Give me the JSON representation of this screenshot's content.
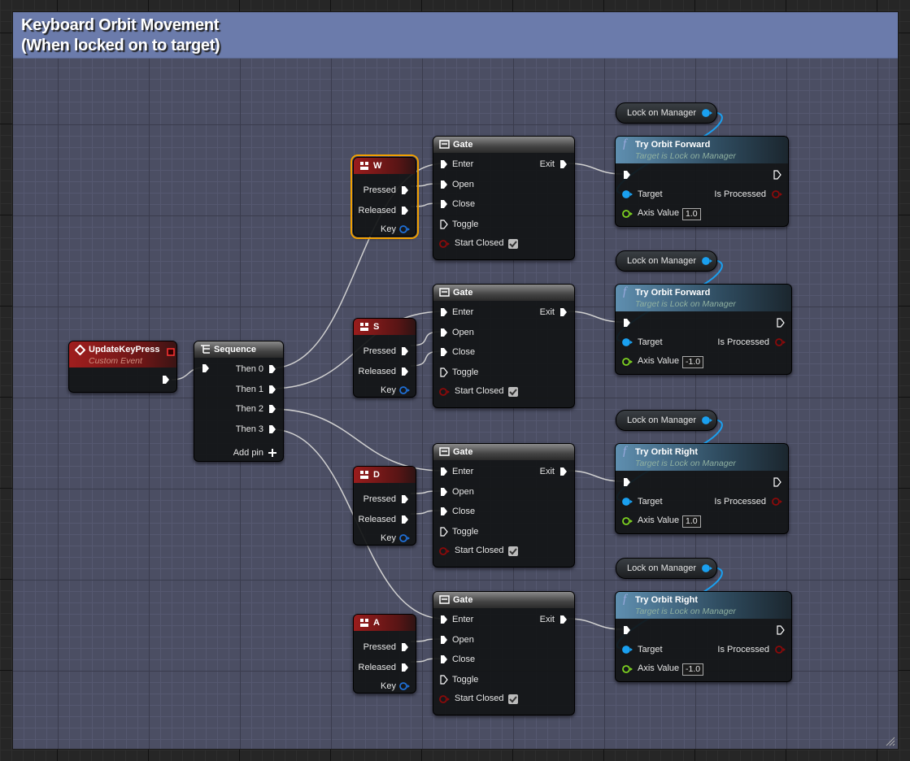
{
  "comment": {
    "title_line1": "Keyboard Orbit Movement",
    "title_line2": "(When locked on to target)",
    "color": "#6b7bab"
  },
  "event": {
    "title": "UpdateKeyPress",
    "subtitle": "Custom Event",
    "icon": "event-diamond-icon"
  },
  "sequence": {
    "title": "Sequence",
    "outputs": [
      "Then 0",
      "Then 1",
      "Then 2",
      "Then 3"
    ],
    "add_pin": "Add pin",
    "icon": "sequence-icon"
  },
  "groups": [
    {
      "key": {
        "name": "W",
        "pressed": "Pressed",
        "released": "Released",
        "key": "Key",
        "selected": true
      },
      "gate": {
        "title": "Gate",
        "inputs": [
          "Enter",
          "Open",
          "Close",
          "Toggle"
        ],
        "start_closed": "Start Closed",
        "start_closed_checked": true,
        "exit": "Exit"
      },
      "func": {
        "title": "Try Orbit Forward",
        "subtitle": "Target is Lock on Manager",
        "target": "Target",
        "is_processed": "Is Processed",
        "axis_label": "Axis Value",
        "axis_value": "1.0"
      },
      "manager": "Lock on Manager"
    },
    {
      "key": {
        "name": "S",
        "pressed": "Pressed",
        "released": "Released",
        "key": "Key",
        "selected": false
      },
      "gate": {
        "title": "Gate",
        "inputs": [
          "Enter",
          "Open",
          "Close",
          "Toggle"
        ],
        "start_closed": "Start Closed",
        "start_closed_checked": true,
        "exit": "Exit"
      },
      "func": {
        "title": "Try Orbit Forward",
        "subtitle": "Target is Lock on Manager",
        "target": "Target",
        "is_processed": "Is Processed",
        "axis_label": "Axis Value",
        "axis_value": "-1.0"
      },
      "manager": "Lock on Manager"
    },
    {
      "key": {
        "name": "D",
        "pressed": "Pressed",
        "released": "Released",
        "key": "Key",
        "selected": false
      },
      "gate": {
        "title": "Gate",
        "inputs": [
          "Enter",
          "Open",
          "Close",
          "Toggle"
        ],
        "start_closed": "Start Closed",
        "start_closed_checked": true,
        "exit": "Exit"
      },
      "func": {
        "title": "Try Orbit Right",
        "subtitle": "Target is Lock on Manager",
        "target": "Target",
        "is_processed": "Is Processed",
        "axis_label": "Axis Value",
        "axis_value": "1.0"
      },
      "manager": "Lock on Manager"
    },
    {
      "key": {
        "name": "A",
        "pressed": "Pressed",
        "released": "Released",
        "key": "Key",
        "selected": false
      },
      "gate": {
        "title": "Gate",
        "inputs": [
          "Enter",
          "Open",
          "Close",
          "Toggle"
        ],
        "start_closed": "Start Closed",
        "start_closed_checked": true,
        "exit": "Exit"
      },
      "func": {
        "title": "Try Orbit Right",
        "subtitle": "Target is Lock on Manager",
        "target": "Target",
        "is_processed": "Is Processed",
        "axis_label": "Axis Value",
        "axis_value": "-1.0"
      },
      "manager": "Lock on Manager"
    }
  ],
  "colors": {
    "exec_wire": "#d0d0d0",
    "object_wire": "#1aa0f0",
    "selection": "#f1a000",
    "event_header": "#9a1c1c",
    "function_header": "#5f8fb0"
  }
}
